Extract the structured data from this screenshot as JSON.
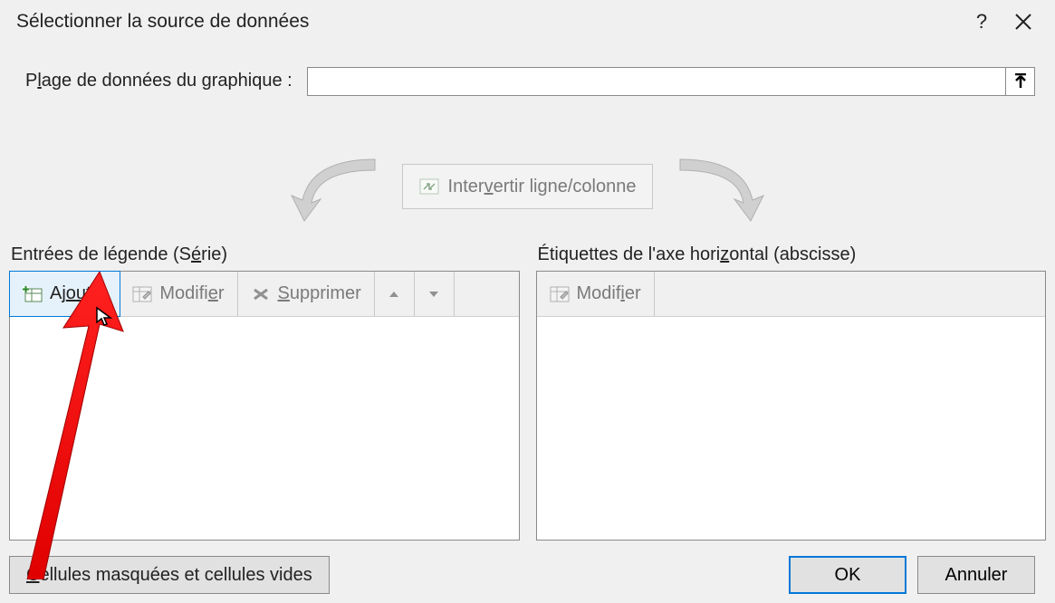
{
  "title": "Sélectionner la source de données",
  "range": {
    "label_pre": "P",
    "label_ul": "l",
    "label_post": "age de données du graphique :",
    "value": ""
  },
  "swap": {
    "pre": "Inter",
    "ul": "v",
    "post": "ertir ligne/colonne"
  },
  "legend_label": {
    "pre": "Entrées de légende (S",
    "ul": "é",
    "post": "rie)"
  },
  "axis_label": {
    "pre": "Étiquettes de l'axe hori",
    "ul": "z",
    "post": "ontal (abscisse)"
  },
  "buttons": {
    "add": {
      "pre": "Aj",
      "ul": "o",
      "mid": "u",
      "post": "ter"
    },
    "edit_series": {
      "pre": "Modifi",
      "ul": "e",
      "post": "r"
    },
    "delete": {
      "pre": "",
      "ul": "S",
      "post": "upprimer"
    },
    "edit_axis": {
      "pre": "Modif",
      "ul": "i",
      "post": "er"
    },
    "hidden": {
      "pre": "",
      "ul": "C",
      "post": "ellules masquées et cellules vides"
    },
    "ok": "OK",
    "cancel": "Annuler"
  }
}
